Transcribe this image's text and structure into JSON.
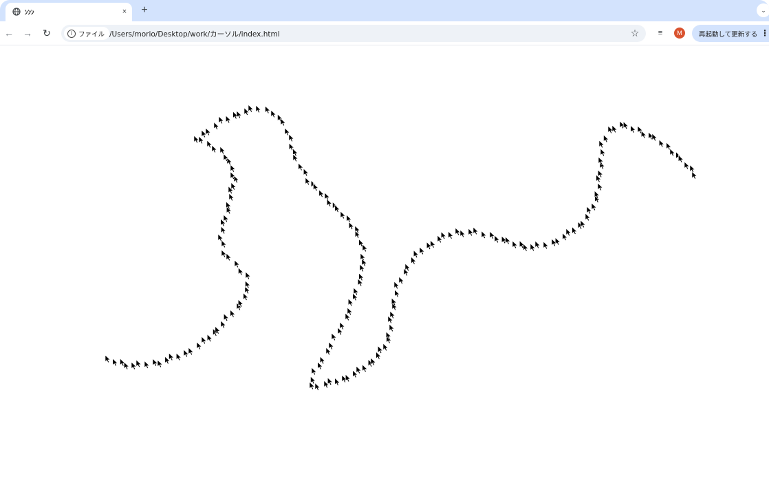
{
  "browser": {
    "tab": {
      "title": "ﾝﾝﾝ",
      "favicon": "globe-icon",
      "close_glyph": "×"
    },
    "new_tab_glyph": "+",
    "tab_menu_glyph": "⌄",
    "toolbar": {
      "back_glyph": "←",
      "forward_glyph": "→",
      "reload_glyph": "↻",
      "info_glyph": "i",
      "info_chip_label": "ファイル",
      "url": "/Users/morio/Desktop/work/カーソル/index.html",
      "bookmark_glyph": "☆",
      "extension_glyph": "≡",
      "avatar_initial": "M",
      "avatar_color": "#d9532f",
      "update_button_label": "再起動して更新する",
      "menu_glyph": "⋮"
    }
  },
  "page": {
    "background": "#ffffff",
    "cursor_color": "#000000"
  }
}
